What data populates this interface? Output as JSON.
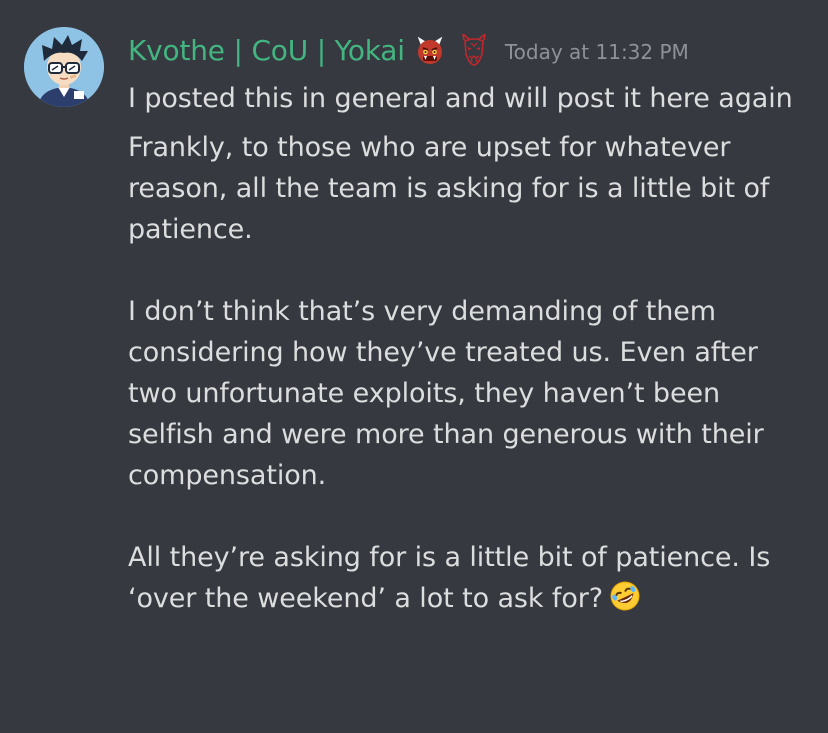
{
  "message": {
    "author": "Kvothe | CoU | Yokai",
    "author_color": "#43b581",
    "author_badges": [
      "ogre-emoji-icon",
      "red-oni-mask-icon"
    ],
    "timestamp": "Today at 11:32 PM",
    "paragraphs": [
      "I posted this in general and will post it here again",
      "Frankly, to those who are upset for whatever reason, all the team is asking for is a little bit of patience.",
      "I don’t think that’s very demanding of them considering how they’ve treated us. Even after two unfortunate exploits, they haven’t been selfish and were more than generous with their compensation.",
      "All they’re asking for is a little bit of patience. Is ‘over the weekend’ a lot to ask for?"
    ],
    "trailing_emoji": "rolling-on-floor-laughing-emoji-icon"
  },
  "theme": {
    "background": "#36393f",
    "text": "#dcddde",
    "muted": "#8e9297"
  }
}
